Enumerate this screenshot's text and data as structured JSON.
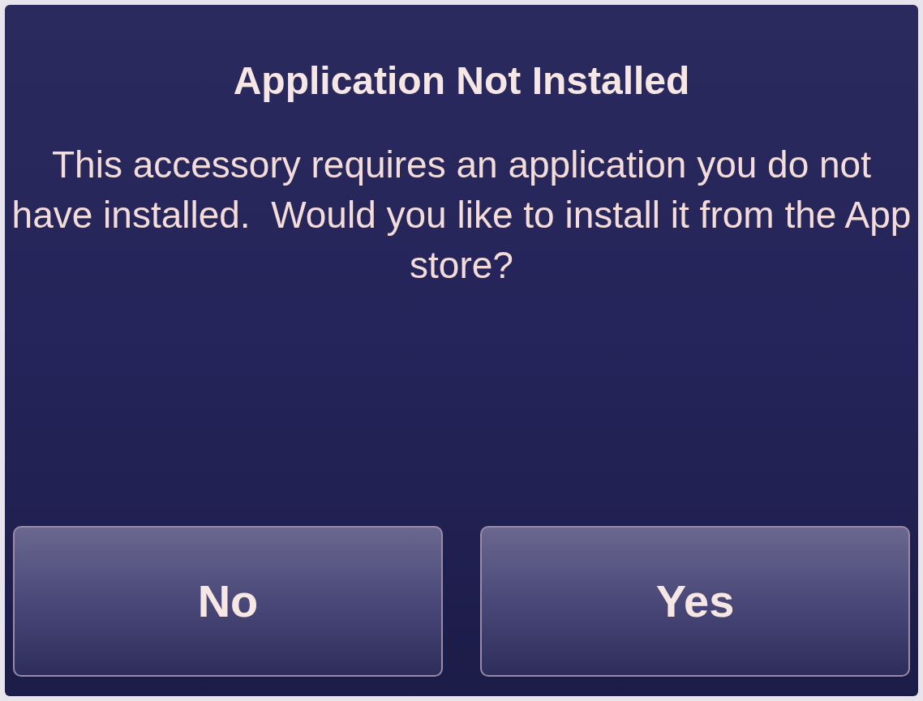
{
  "alert": {
    "title": "Application Not Installed",
    "message": "This accessory requires an application you do not have installed.  Would you like to install it from the App store?",
    "buttons": [
      {
        "label": "No"
      },
      {
        "label": "Yes"
      }
    ]
  }
}
